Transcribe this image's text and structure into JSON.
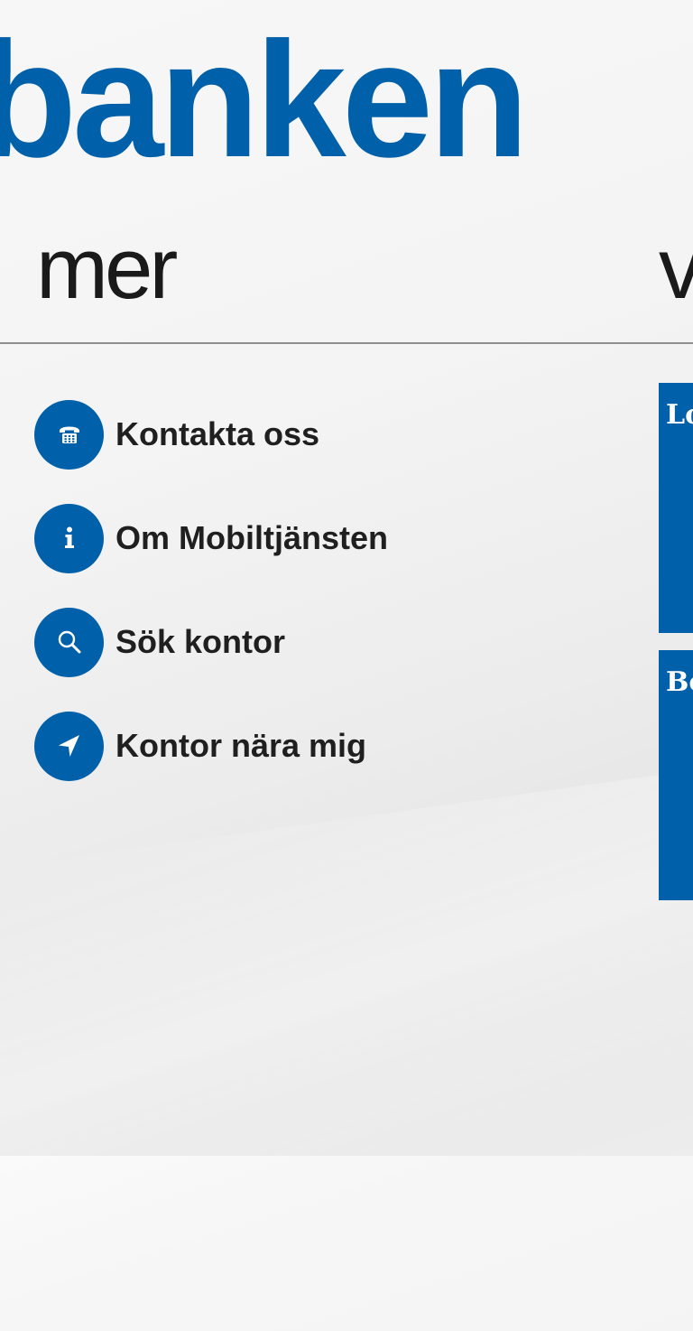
{
  "app": {
    "title": "banken"
  },
  "pivot": {
    "current": "mer",
    "next": "v"
  },
  "menu": {
    "items": [
      {
        "label": "Kontakta oss",
        "icon": "phone-icon"
      },
      {
        "label": "Om Mobiltjänsten",
        "icon": "info-icon"
      },
      {
        "label": "Sök kontor",
        "icon": "search-icon"
      },
      {
        "label": "Kontor nära mig",
        "icon": "location-arrow-icon"
      }
    ]
  },
  "tiles": [
    {
      "label": "Lo"
    },
    {
      "label": "Bo"
    }
  ],
  "colors": {
    "brand": "#0060a9",
    "text": "#1f1f1f",
    "divider": "#8f8f8f"
  }
}
